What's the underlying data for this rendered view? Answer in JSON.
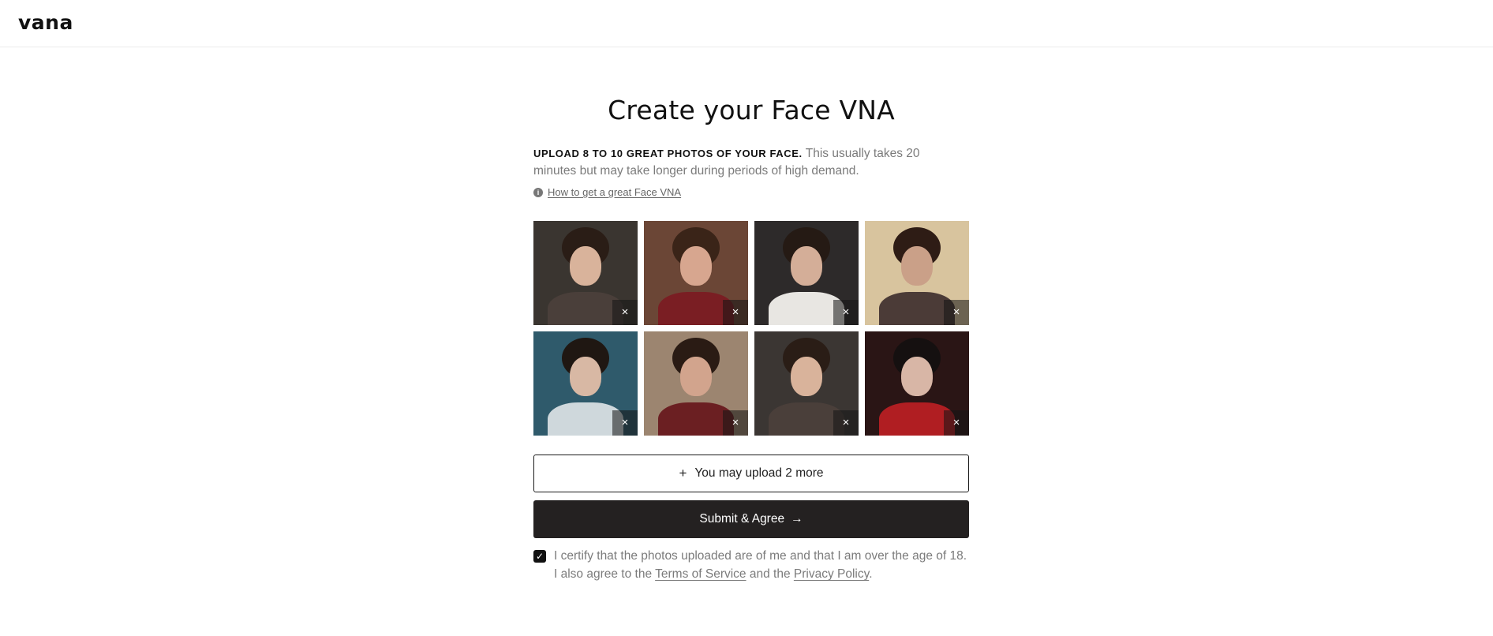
{
  "header": {
    "logo_text": "vana"
  },
  "main": {
    "title": "Create your Face VNA",
    "description_strong": "UPLOAD 8 TO 10 GREAT PHOTOS OF YOUR FACE.",
    "description_rest": " This usually takes 20 minutes but may take longer during periods of high demand.",
    "help_link": "How to get a great Face VNA",
    "upload_label": "You may upload 2 more",
    "upload_icon": "+",
    "submit_label": "Submit & Agree",
    "submit_icon": "→",
    "certify_line1": "I certify that the photos uploaded are of me and that I am over the age of 18.",
    "certify_line2_prefix": "I also agree to the ",
    "terms_link": "Terms of Service",
    "certify_mid": " and the ",
    "privacy_link": "Privacy Policy",
    "certify_end": ".",
    "certify_checked": true
  },
  "photos": [
    {
      "remove_icon": "×",
      "bg": "#3a3530",
      "hair": "#2a1d16",
      "skin": "#d9b39b",
      "shirt": "#4a3f3a"
    },
    {
      "remove_icon": "×",
      "bg": "#6b4636",
      "hair": "#3a2418",
      "skin": "#d7a68f",
      "shirt": "#7a1e23"
    },
    {
      "remove_icon": "×",
      "bg": "#2d2a2a",
      "hair": "#251a14",
      "skin": "#d4ae98",
      "shirt": "#e8e6e2"
    },
    {
      "remove_icon": "×",
      "bg": "#d8c49e",
      "hair": "#2e1c15",
      "skin": "#caa088",
      "shirt": "#4b3b37"
    },
    {
      "remove_icon": "×",
      "bg": "#2f5a6b",
      "hair": "#1f1712",
      "skin": "#d8b8a4",
      "shirt": "#cfd8dc"
    },
    {
      "remove_icon": "×",
      "bg": "#9c8570",
      "hair": "#2a1b14",
      "skin": "#d2a48d",
      "shirt": "#6b1f22"
    },
    {
      "remove_icon": "×",
      "bg": "#3b3633",
      "hair": "#2a1d16",
      "skin": "#d9b39b",
      "shirt": "#4a3f3a"
    },
    {
      "remove_icon": "×",
      "bg": "#2a1515",
      "hair": "#151010",
      "skin": "#d8b6a6",
      "shirt": "#b01e22"
    }
  ],
  "icons": {
    "info": "info-icon",
    "remove": "close-icon",
    "check": "checkmark-icon"
  }
}
